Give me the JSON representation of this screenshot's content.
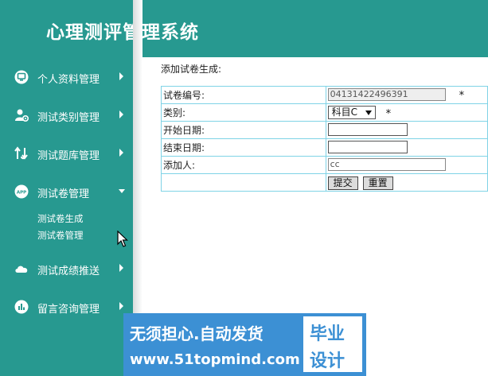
{
  "header": {
    "title": "心理测评管理系统"
  },
  "sidebar": {
    "items": [
      {
        "label": "个人资料管理",
        "icon": "monitor-icon"
      },
      {
        "label": "测试类别管理",
        "icon": "user-gear-icon"
      },
      {
        "label": "测试题库管理",
        "icon": "swap-arrows-icon"
      },
      {
        "label": "测试卷管理",
        "icon": "app-icon",
        "icon_text": "APP",
        "expanded": true,
        "children": [
          {
            "label": "测试卷生成"
          },
          {
            "label": "测试卷管理"
          }
        ]
      },
      {
        "label": "测试成绩推送",
        "icon": "cloud-icon"
      },
      {
        "label": "留言咨询管理",
        "icon": "bar-chart-icon"
      }
    ]
  },
  "content": {
    "heading": "添加试卷生成:",
    "form": {
      "rows": [
        {
          "label": "试卷编号:",
          "value": "04131422496391",
          "required_mark": "*"
        },
        {
          "label": "类别:",
          "selected": "科目C",
          "required_mark": "*"
        },
        {
          "label": "开始日期:",
          "value": ""
        },
        {
          "label": "结束日期:",
          "value": ""
        },
        {
          "label": "添加人:",
          "value": "cc"
        }
      ],
      "submit_label": "提交",
      "reset_label": "重置"
    }
  },
  "watermark": {
    "line1": "无须担心.自动发货",
    "line2": "www.51topmind.com",
    "box_line1": "毕业",
    "box_line2": "设计"
  },
  "colors": {
    "primary": "#279990",
    "table_border": "#7fd3e6",
    "watermark_blue": "#3c90d4"
  }
}
